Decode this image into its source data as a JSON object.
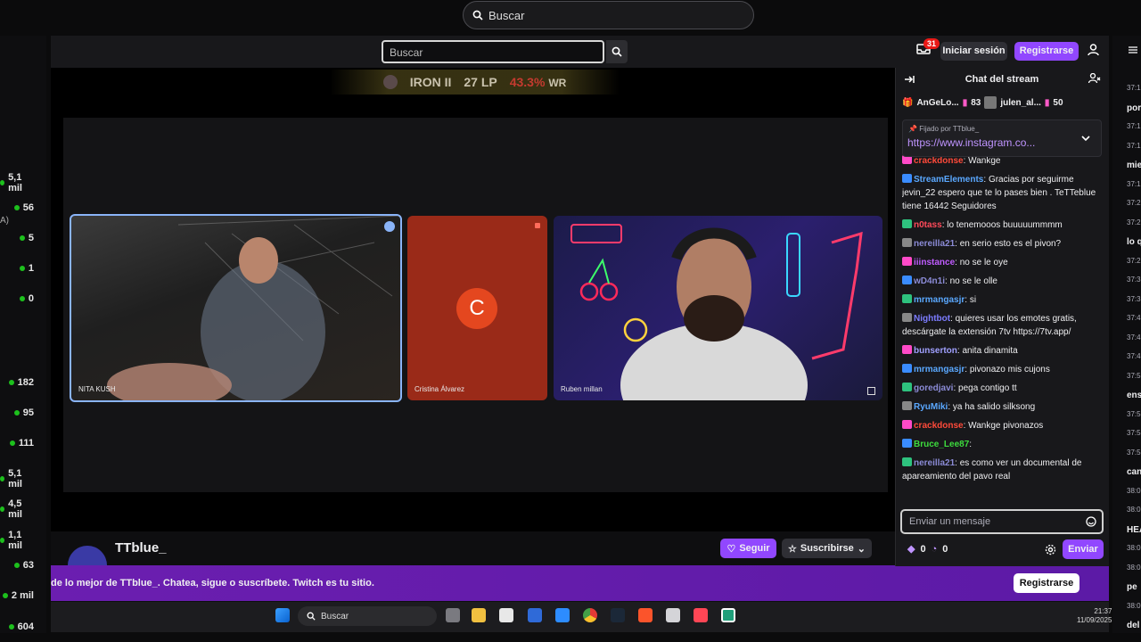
{
  "browser": {
    "search_placeholder": "Buscar"
  },
  "left_counts": [
    "5,1 mil",
    "56",
    "5",
    "1",
    "0",
    "182",
    "95",
    "111",
    "5,1 mil",
    "4,5 mil",
    "1,1 mil",
    "63",
    "2 mil",
    "604"
  ],
  "left_fragment": "A)",
  "nav": {
    "search_placeholder": "Buscar",
    "inbox_count": "31",
    "login_label": "Iniciar sesión",
    "signup_label": "Registrarse"
  },
  "stream": {
    "rank": "IRON II",
    "lp": "27 LP",
    "wr_value": "43.3%",
    "wr_label": "WR",
    "participants": [
      {
        "name": "NITA KUSH"
      },
      {
        "name": "Cristina Álvarez",
        "initial": "C"
      },
      {
        "name": "Ruben millan"
      }
    ]
  },
  "channel": {
    "name": "TTblue_",
    "follow_label": "Seguir",
    "subscribe_label": "Suscribirse"
  },
  "promo": {
    "text": "de lo mejor de TTblue_. Chatea, sigue o suscríbete. Twitch es tu sitio.",
    "button_label": "Registrarse"
  },
  "chat": {
    "title": "Chat del stream",
    "gifters": [
      {
        "name": "AnGeLo...",
        "count": "83"
      },
      {
        "name": "julen_al...",
        "count": "50"
      }
    ],
    "pinned_by": "Fijado por",
    "pinned_user": "TTblue_",
    "pinned_link": "https://www.instagram.co...",
    "messages": [
      {
        "user": "crackdonse",
        "color": "#ff4a3a",
        "text": "Wankge"
      },
      {
        "user": "StreamElements",
        "color": "#5aa8ff",
        "text": "Gracias por seguirme jevin_22 espero que te lo pases bien . TeTTeblue tiene 16442 Seguidores"
      },
      {
        "user": "n0tass",
        "color": "#ff4a5a",
        "text": "lo tenemooos buuuuummmm"
      },
      {
        "user": "nereilla21",
        "color": "#8b8bd6",
        "text": "en serio esto es el pivon?"
      },
      {
        "user": "iiinstance",
        "color": "#c05cff",
        "text": "no se le oye"
      },
      {
        "user": "wD4n1i",
        "color": "#8b8bd6",
        "text": "no se le olle"
      },
      {
        "user": "mrmangasjr",
        "color": "#5aa8ff",
        "text": "si"
      },
      {
        "user": "Nightbot",
        "color": "#7c7cff",
        "text": "quieres usar los emotes gratis, descárgate la extensión 7tv https://7tv.app/"
      },
      {
        "user": "bunserton",
        "color": "#a0a0ff",
        "text": "anita dinamita"
      },
      {
        "user": "mrmangasjr",
        "color": "#5aa8ff",
        "text": "pivonazo mis cujons"
      },
      {
        "user": "goredjavi",
        "color": "#8b8bd6",
        "text": "pega contigo tt"
      },
      {
        "user": "RyuMiki",
        "color": "#5aa8ff",
        "text": "ya ha salido silksong"
      },
      {
        "user": "crackdonse",
        "color": "#ff4a3a",
        "text": "Wankge pivonazos"
      },
      {
        "user": "Bruce_Lee87",
        "color": "#3ddc3d",
        "text": ""
      },
      {
        "user": "nereilla21",
        "color": "#8b8bd6",
        "text": "es como ver un documental de apareamiento del pavo real"
      }
    ],
    "input_placeholder": "Enviar un mensaje",
    "bits": "0",
    "points": "0",
    "send_label": "Enviar"
  },
  "right_strip": [
    {
      "t": "37:1",
      "b": false
    },
    {
      "t": "por",
      "b": true
    },
    {
      "t": "37:1",
      "b": false
    },
    {
      "t": "37:1",
      "b": false
    },
    {
      "t": "mie",
      "b": true
    },
    {
      "t": "37:1",
      "b": false
    },
    {
      "t": "37:2",
      "b": false
    },
    {
      "t": "37:2",
      "b": false
    },
    {
      "t": "lo q",
      "b": true
    },
    {
      "t": "37:2",
      "b": false
    },
    {
      "t": "37:3",
      "b": false
    },
    {
      "t": "37:3",
      "b": false
    },
    {
      "t": "37:4",
      "b": false
    },
    {
      "t": "37:4",
      "b": false
    },
    {
      "t": "37:4",
      "b": false
    },
    {
      "t": "37:5",
      "b": false
    },
    {
      "t": "ens",
      "b": true
    },
    {
      "t": "37:5",
      "b": false
    },
    {
      "t": "37:5",
      "b": false
    },
    {
      "t": "37:5",
      "b": false
    },
    {
      "t": "can",
      "b": true
    },
    {
      "t": "38:0",
      "b": false
    },
    {
      "t": "38:0",
      "b": false
    },
    {
      "t": "HEA",
      "b": true
    },
    {
      "t": "38:0",
      "b": false
    },
    {
      "t": "38:0",
      "b": false
    },
    {
      "t": "pe",
      "b": true
    },
    {
      "t": "38:0",
      "b": false
    },
    {
      "t": "del",
      "b": true
    }
  ],
  "taskbar": {
    "search_label": "Buscar",
    "time": "21:37",
    "date": "11/09/2025"
  },
  "colors": {
    "accent": "#9147ff",
    "live": "#1dc01d"
  }
}
